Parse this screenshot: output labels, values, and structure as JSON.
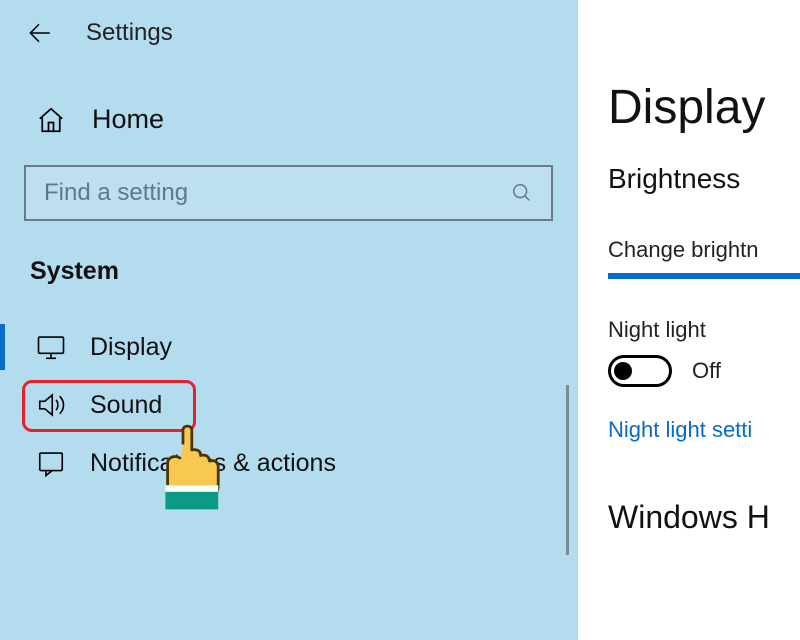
{
  "header": {
    "app_title": "Settings"
  },
  "sidebar": {
    "home_label": "Home",
    "search_placeholder": "Find a setting",
    "section_heading": "System",
    "items": [
      {
        "label": "Display",
        "icon": "display",
        "active": true
      },
      {
        "label": "Sound",
        "icon": "sound",
        "active": false
      },
      {
        "label": "Notifications & actions",
        "icon": "notifications",
        "active": false
      }
    ]
  },
  "main": {
    "title": "Display",
    "brightness_heading": "Brightness",
    "brightness_text": "Change brightn",
    "night_light_label": "Night light",
    "night_light_state": "Off",
    "night_light_link": "Night light setti",
    "second_section": "Windows H"
  }
}
